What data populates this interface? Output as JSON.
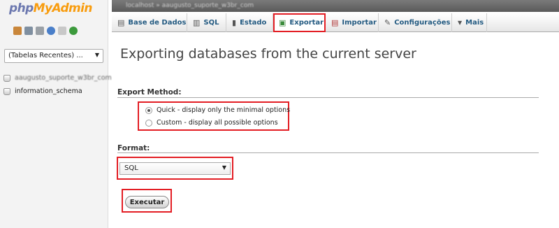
{
  "nav": {
    "logo_php": "php",
    "logo_myadmin": "MyAdmin",
    "icons": [
      "home-icon",
      "database-icon",
      "docs-icon",
      "help-icon",
      "settings-icon",
      "reload-icon"
    ],
    "recent_tables": "(Tabelas Recentes) ...",
    "databases": [
      "aaugusto_suporte_w3br_com",
      "information_schema"
    ]
  },
  "header": {
    "breadcrumb": "localhost » aaugusto_suporte_w3br_com"
  },
  "tabs": [
    {
      "label": "Base de Dados",
      "icon": "database-icon"
    },
    {
      "label": "SQL",
      "icon": "sql-icon"
    },
    {
      "label": "Estado",
      "icon": "status-icon"
    },
    {
      "label": "Exportar",
      "icon": "export-icon",
      "active": true
    },
    {
      "label": "Importar",
      "icon": "import-icon"
    },
    {
      "label": "Configurações",
      "icon": "wrench-icon"
    },
    {
      "label": "Mais",
      "icon": "chevron-down-icon"
    }
  ],
  "main": {
    "title": "Exporting databases from the current server",
    "export_method_label": "Export Method:",
    "method_options": [
      {
        "label": "Quick - display only the minimal options",
        "selected": true
      },
      {
        "label": "Custom - display all possible options",
        "selected": false
      }
    ],
    "format_label": "Format:",
    "format_value": "SQL",
    "execute_label": "Executar"
  },
  "colors": {
    "highlight": "#e31e24",
    "tab_text": "#235a81",
    "logo_php": "#6c78af",
    "logo_myadmin": "#f89c0e"
  }
}
